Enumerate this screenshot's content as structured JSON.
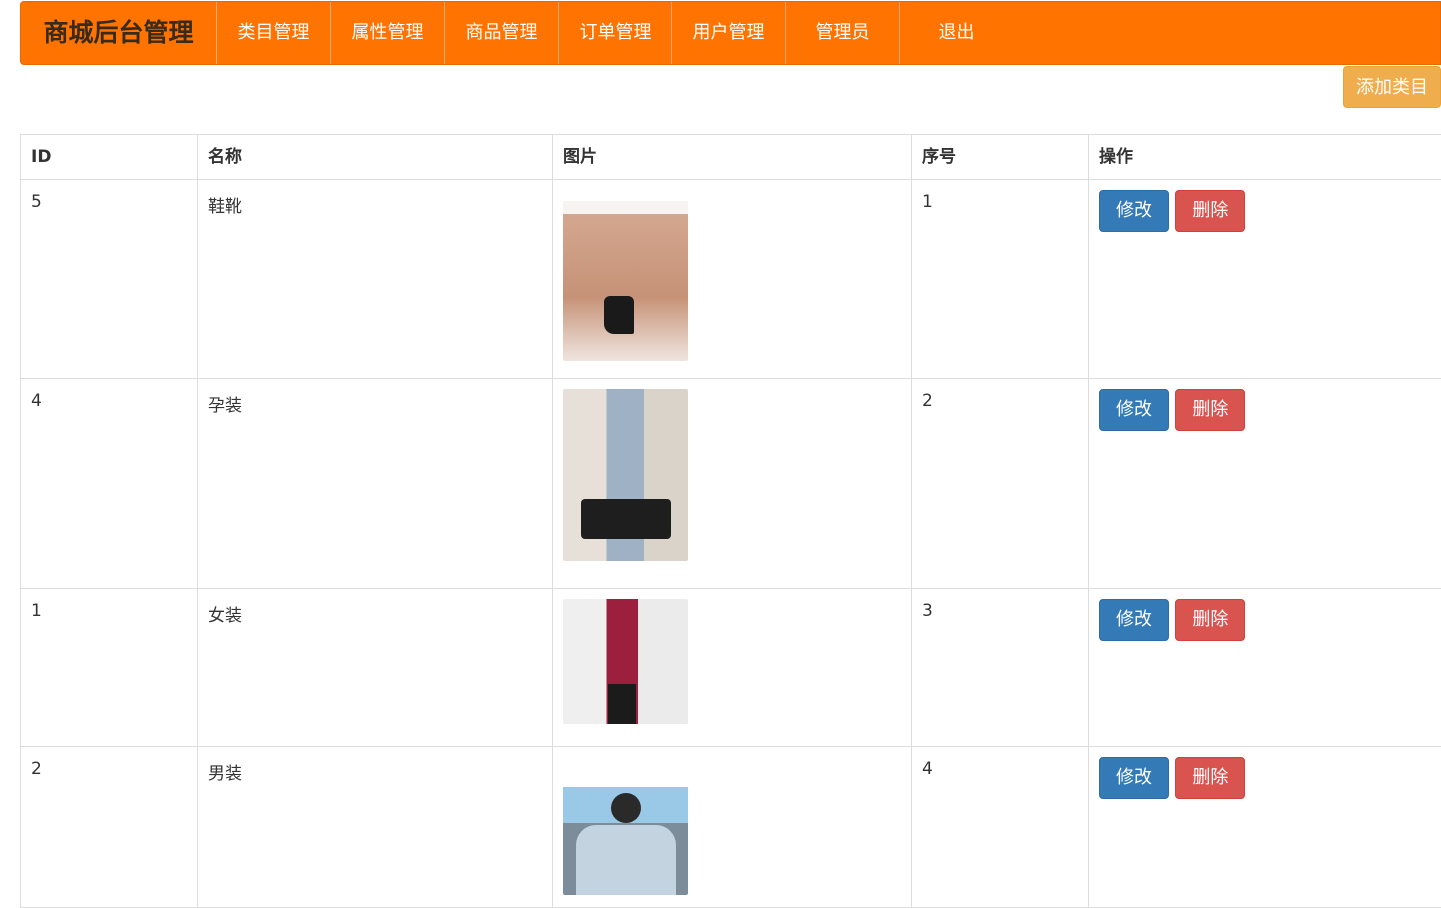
{
  "nav": {
    "brand": "商城后台管理",
    "items": [
      "类目管理",
      "属性管理",
      "商品管理",
      "订单管理",
      "用户管理",
      "管理员",
      "退出"
    ]
  },
  "toolbar": {
    "add_label": "添加类目"
  },
  "table": {
    "headers": [
      "ID",
      "名称",
      "图片",
      "序号",
      "操作"
    ],
    "rows": [
      {
        "id": "5",
        "name": "鞋靴",
        "order": "1",
        "edit": "修改",
        "del": "删除"
      },
      {
        "id": "4",
        "name": "孕装",
        "order": "2",
        "edit": "修改",
        "del": "删除"
      },
      {
        "id": "1",
        "name": "女装",
        "order": "3",
        "edit": "修改",
        "del": "删除"
      },
      {
        "id": "2",
        "name": "男装",
        "order": "4",
        "edit": "修改",
        "del": "删除"
      }
    ]
  }
}
